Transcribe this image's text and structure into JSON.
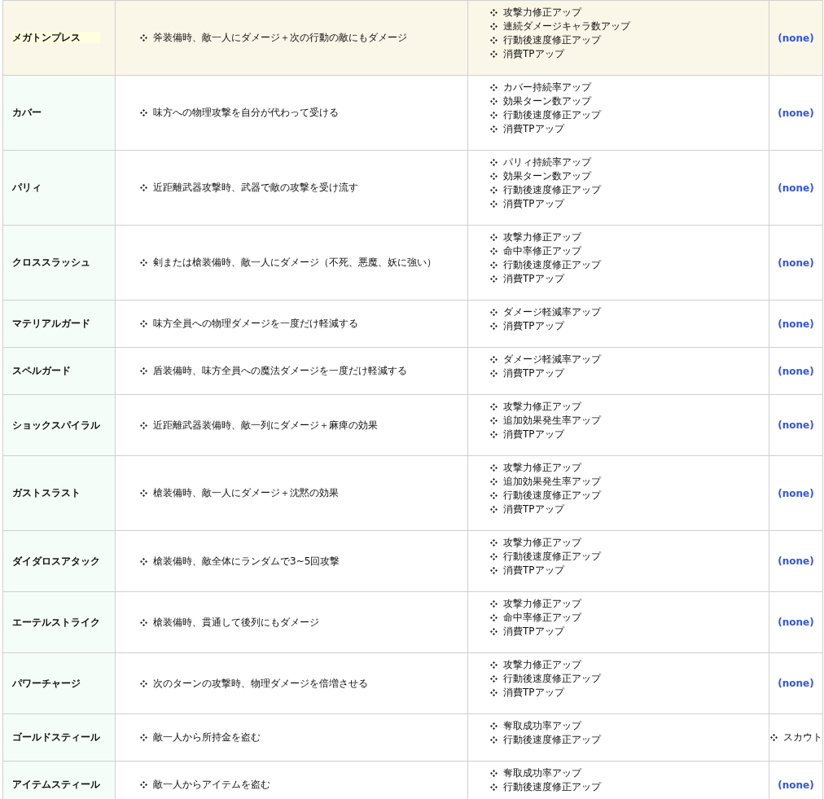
{
  "rows": [
    {
      "name": "メガトンプレス",
      "highlighted": true,
      "description": "斧装備時、敵一人にダメージ＋次の行動の敵にもダメージ",
      "upgrades": [
        "攻撃力修正アップ",
        "連続ダメージキャラ数アップ",
        "行動後速度修正アップ",
        "消費TPアップ"
      ],
      "unlocks": {
        "kind": "none",
        "text": "(none)"
      }
    },
    {
      "name": "カバー",
      "highlighted": false,
      "description": "味方への物理攻撃を自分が代わって受ける",
      "upgrades": [
        "カバー持続率アップ",
        "効果ターン数アップ",
        "行動後速度修正アップ",
        "消費TPアップ"
      ],
      "unlocks": {
        "kind": "none",
        "text": "(none)"
      }
    },
    {
      "name": "パリィ",
      "highlighted": false,
      "description": "近距離武器攻撃時、武器で敵の攻撃を受け流す",
      "upgrades": [
        "パリィ持続率アップ",
        "効果ターン数アップ",
        "行動後速度修正アップ",
        "消費TPアップ"
      ],
      "unlocks": {
        "kind": "none",
        "text": "(none)"
      }
    },
    {
      "name": "クロススラッシュ",
      "highlighted": false,
      "description": "剣または槍装備時、敵一人にダメージ（不死、悪魔、妖に強い）",
      "upgrades": [
        "攻撃力修正アップ",
        "命中率修正アップ",
        "行動後速度修正アップ",
        "消費TPアップ"
      ],
      "unlocks": {
        "kind": "none",
        "text": "(none)"
      }
    },
    {
      "name": "マテリアルガード",
      "highlighted": false,
      "description": "味方全員への物理ダメージを一度だけ軽減する",
      "upgrades": [
        "ダメージ軽減率アップ",
        "消費TPアップ"
      ],
      "unlocks": {
        "kind": "none",
        "text": "(none)"
      }
    },
    {
      "name": "スペルガード",
      "highlighted": false,
      "description": "盾装備時、味方全員への魔法ダメージを一度だけ軽減する",
      "upgrades": [
        "ダメージ軽減率アップ",
        "消費TPアップ"
      ],
      "unlocks": {
        "kind": "none",
        "text": "(none)"
      }
    },
    {
      "name": "ショックスパイラル",
      "highlighted": false,
      "description": "近距離武器装備時、敵一列にダメージ＋麻痺の効果",
      "upgrades": [
        "攻撃力修正アップ",
        "追加効果発生率アップ",
        "消費TPアップ"
      ],
      "unlocks": {
        "kind": "none",
        "text": "(none)"
      }
    },
    {
      "name": "ガストスラスト",
      "highlighted": false,
      "description": "槍装備時、敵一人にダメージ＋沈黙の効果",
      "upgrades": [
        "攻撃力修正アップ",
        "追加効果発生率アップ",
        "行動後速度修正アップ",
        "消費TPアップ"
      ],
      "unlocks": {
        "kind": "none",
        "text": "(none)"
      }
    },
    {
      "name": "ダイダロスアタック",
      "highlighted": false,
      "description": "槍装備時、敵全体にランダムで3~5回攻撃",
      "upgrades": [
        "攻撃力修正アップ",
        "行動後速度修正アップ",
        "消費TPアップ"
      ],
      "unlocks": {
        "kind": "none",
        "text": "(none)"
      }
    },
    {
      "name": "エーテルストライク",
      "highlighted": false,
      "description": "槍装備時、貫通して後列にもダメージ",
      "upgrades": [
        "攻撃力修正アップ",
        "命中率修正アップ",
        "消費TPアップ"
      ],
      "unlocks": {
        "kind": "none",
        "text": "(none)"
      }
    },
    {
      "name": "パワーチャージ",
      "highlighted": false,
      "description": "次のターンの攻撃時、物理ダメージを倍増させる",
      "upgrades": [
        "攻撃力修正アップ",
        "行動後速度修正アップ",
        "消費TPアップ"
      ],
      "unlocks": {
        "kind": "none",
        "text": "(none)"
      }
    },
    {
      "name": "ゴールドスティール",
      "highlighted": false,
      "description": "敵一人から所持金を盗む",
      "upgrades": [
        "奪取成功率アップ",
        "行動後速度修正アップ"
      ],
      "unlocks": {
        "kind": "list",
        "items": [
          "スカウト"
        ]
      }
    },
    {
      "name": "アイテムスティール",
      "highlighted": false,
      "description": "敵一人からアイテムを盗む",
      "upgrades": [
        "奪取成功率アップ",
        "行動後速度修正アップ"
      ],
      "unlocks": {
        "kind": "none",
        "text": "(none)"
      }
    }
  ]
}
